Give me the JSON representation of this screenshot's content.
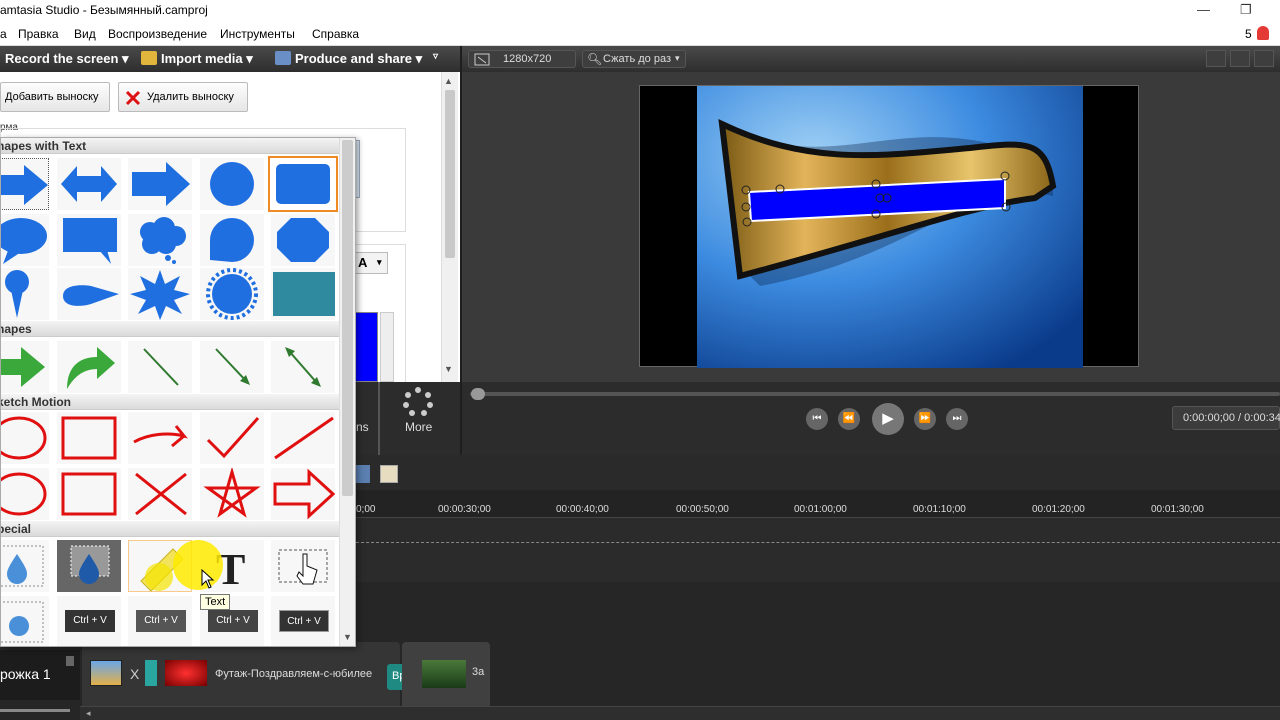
{
  "window": {
    "title": "amtasia Studio - Безымянный.camproj",
    "notif_count": "5"
  },
  "menu": [
    "Правка",
    "Вид",
    "Воспроизведение",
    "Инструменты",
    "Справка"
  ],
  "toolbar": {
    "record": "Record the screen ▾",
    "import": "Import media ▾",
    "produce": "Produce and share ▾"
  },
  "callouts": {
    "add": "Добавить выноску",
    "remove": "Удалить выноску",
    "shape_label": "рма",
    "font_btn": "A"
  },
  "gallery": {
    "sections": [
      "hapes with Text",
      "hapes",
      "ketch Motion",
      "pecial"
    ],
    "tooltip": "Text",
    "ctrl_v": "Ctrl + V"
  },
  "preview": {
    "resolution": "1280x720",
    "zoom": "Сжать до раз",
    "time": "0:00:00;00 / 0:00:34"
  },
  "tools": {
    "more": "More",
    "partial": "ns"
  },
  "ruler": [
    "0;00",
    "00:00:30;00",
    "00:00:40;00",
    "00:00:50;00",
    "00:01:00;00",
    "00:01:10;00",
    "00:01:20;00",
    "00:01:30;00"
  ],
  "taskbar": {
    "track": "рожка 1",
    "x": "X",
    "clip": "Футаж-Поздравляем-с-юбилее",
    "bp": "Bp",
    "tail": "3a"
  },
  "colors": {
    "accent": "#f08a24",
    "shape_blue": "#1f6fe0",
    "sketch_red": "#e01010",
    "arrow_green": "#3aa83a"
  }
}
